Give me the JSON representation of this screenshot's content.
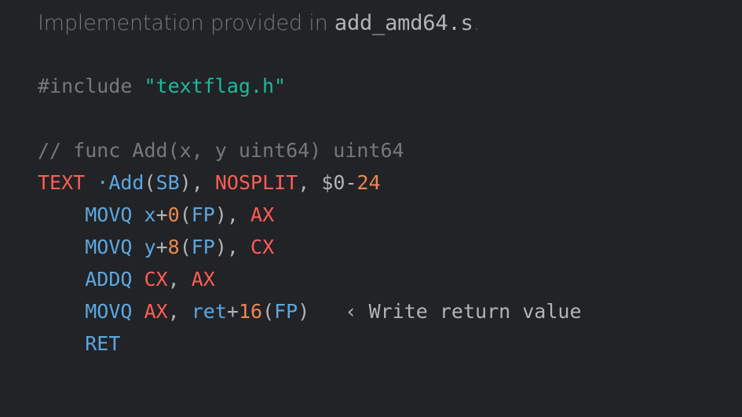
{
  "heading": {
    "prefix": "Implementation provided in ",
    "filename": "add_amd64.s",
    "suffix": "."
  },
  "code": {
    "include": {
      "directive": "#include",
      "header": "\"textflag.h\""
    },
    "sig_comment": "// func Add(x, y uint64) uint64",
    "text_kw": "TEXT",
    "sym": "·Add",
    "sb": "SB",
    "nosplit": "NOSPLIT",
    "frame_dollar_zero": "$0",
    "frame_dash": "-",
    "frame_size": "24",
    "movq": "MOVQ",
    "addq": "ADDQ",
    "ret_kw": "RET",
    "arg_x": "x",
    "arg_y": "y",
    "arg_ret": "ret",
    "plus": "+",
    "off0": "0",
    "off8": "8",
    "off16": "16",
    "fp": "FP",
    "ax": "AX",
    "cx": "CX",
    "lp": "(",
    "rp": ")",
    "comma": ",",
    "note_marker": "‹",
    "note_text": "Write return value"
  }
}
